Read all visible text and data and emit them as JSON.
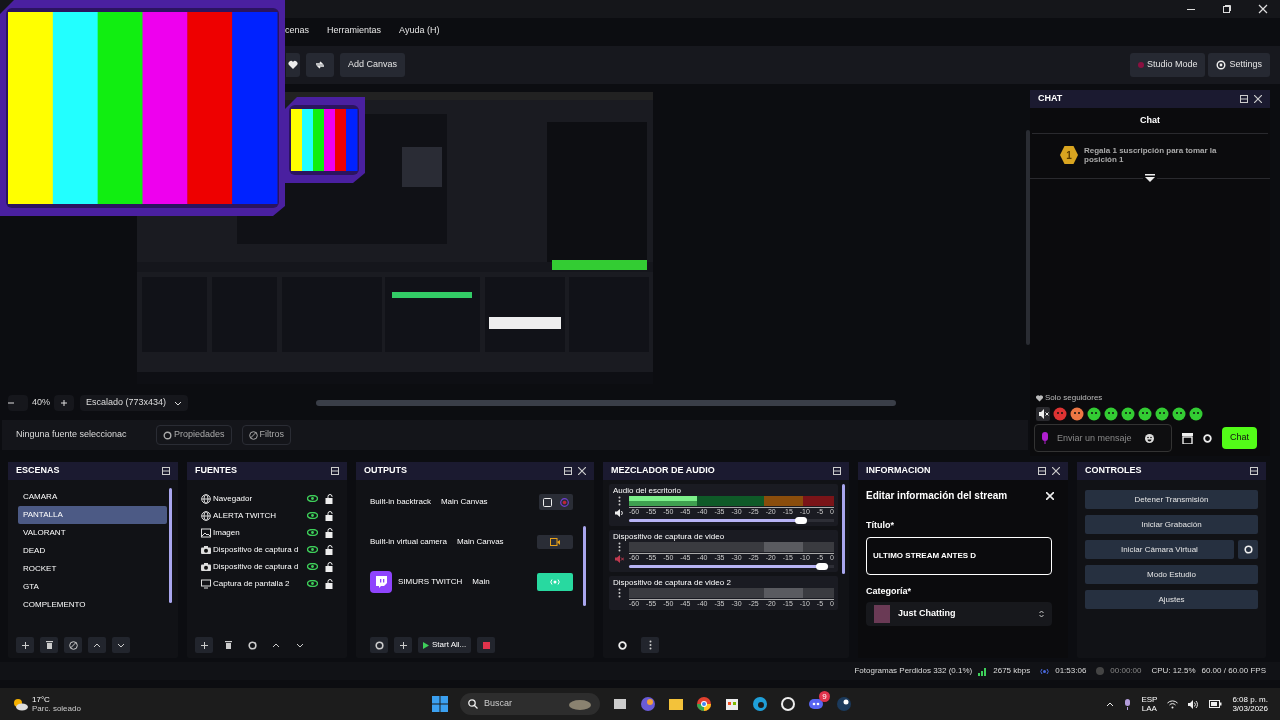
{
  "menu": [
    {
      "label": "cenas"
    },
    {
      "label": "Herramientas"
    },
    {
      "label": "Ayuda (H)"
    }
  ],
  "toolbar": {
    "left": [
      {
        "kind": "heart"
      },
      {
        "kind": "transition"
      },
      {
        "kind": "text",
        "label": "Add Canvas"
      }
    ],
    "right": [
      {
        "kind": "studio",
        "label": "Studio Mode"
      },
      {
        "kind": "settings",
        "label": "Settings"
      }
    ]
  },
  "preview": {
    "zoom": "40%",
    "scale_mode": "Escalado (773x434)"
  },
  "source_bar": {
    "status": "Ninguna fuente seleccionac",
    "buttons": [
      {
        "kind": "gear",
        "label": "Propiedades"
      },
      {
        "kind": "filter",
        "label": "Filtros"
      }
    ]
  },
  "chat": {
    "title": "CHAT",
    "heading": "Chat",
    "pinned_rank": "1",
    "pinned_text": "Regala 1 suscripción para tomar la posición 1",
    "mode": "Solo seguidores",
    "placeholder": "Enviar un mensaje",
    "send_label": "Chat"
  },
  "scenes": {
    "title": "ESCENAS",
    "items": [
      {
        "label": "CAMARA",
        "selected": false
      },
      {
        "label": "PANTALLA",
        "selected": true
      },
      {
        "label": "VALORANT",
        "selected": false
      },
      {
        "label": "DEAD",
        "selected": false
      },
      {
        "label": "ROCKET",
        "selected": false
      },
      {
        "label": "GTA",
        "selected": false
      },
      {
        "label": "COMPLEMENTO",
        "selected": false
      }
    ]
  },
  "sources": {
    "title": "FUENTES",
    "items": [
      {
        "kind": "globe",
        "label": "Navegador",
        "visible": true,
        "locked": false
      },
      {
        "kind": "globe",
        "label": "ALERTA TWITCH",
        "visible": true,
        "locked": false
      },
      {
        "kind": "image",
        "label": "Imagen",
        "visible": true,
        "locked": false
      },
      {
        "kind": "camera",
        "label": "Dispositivo de captura d",
        "visible": true,
        "locked": false
      },
      {
        "kind": "camera",
        "label": "Dispositivo de captura d",
        "visible": true,
        "locked": false
      },
      {
        "kind": "monitor",
        "label": "Captura de pantalla 2",
        "visible": true,
        "locked": false
      }
    ]
  },
  "outputs": {
    "title": "OUTPUTS",
    "rows": [
      {
        "kind": "backtrack",
        "name": "Built-in backtrack",
        "canvas": "Main Canvas"
      },
      {
        "kind": "virtualcam",
        "name": "Built-in virtual camera",
        "canvas": "Main Canvas"
      },
      {
        "kind": "stream",
        "name": "SIMURS TWITCH",
        "canvas": "Main",
        "active": true
      }
    ],
    "start_all": "Start All..."
  },
  "mixer": {
    "title": "MEZCLADOR DE AUDIO",
    "channels": [
      {
        "name": "Audio del escritorio",
        "meter": {
          "level": 0.33
        },
        "scale": [
          "-60",
          "-55",
          "-50",
          "-45",
          "-40",
          "-35",
          "-30",
          "-25",
          "-20",
          "-15",
          "-10",
          "-5",
          "0"
        ],
        "volume": {
          "level": 0.86
        },
        "muted": false
      },
      {
        "name": "Dispositivo de captura de video",
        "scale": [
          "-60",
          "-55",
          "-50",
          "-45",
          "-40",
          "-35",
          "-30",
          "-25",
          "-20",
          "-15",
          "-10",
          "-5",
          "0"
        ],
        "volume": {
          "level": 0.97
        },
        "muted": true
      },
      {
        "name": "Dispositivo de captura de video 2",
        "scale": [
          "-60",
          "-55",
          "-50",
          "-45",
          "-40",
          "-35",
          "-30",
          "-25",
          "-20",
          "-15",
          "-10",
          "-5",
          "0"
        ]
      }
    ]
  },
  "info": {
    "title": "INFORMACION",
    "heading": "Editar información del stream",
    "title_label": "Título*",
    "title_value": "ULTIMO STREAM ANTES D",
    "category_label": "Categoría*",
    "category": "Just Chatting"
  },
  "controls": {
    "title": "CONTROLES",
    "buttons": [
      {
        "label": "Detener Transmisión",
        "gear": false
      },
      {
        "label": "Iniciar Grabación",
        "gear": false
      },
      {
        "label": "Iniciar Cámara Virtual",
        "gear": true
      },
      {
        "label": "Modo Estudio",
        "gear": false
      },
      {
        "label": "Ajustes",
        "gear": false
      }
    ]
  },
  "status_bar": {
    "dropped": "Fotogramas Perdidos 332 (0.1%)",
    "bitrate": "2675 kbps",
    "stream_time": "01:53:06",
    "rec_time": "00:00:00",
    "cpu": "CPU: 12.5%",
    "fps": "60.00 / 60.00 FPS"
  },
  "taskbar": {
    "temperature": "17°C",
    "weather": "Parc. soleado",
    "search": "Buscar",
    "discord_badge": "9",
    "lang": "ESP",
    "layout": "LAA",
    "time": "6:08 p. m.",
    "date": "3/03/2026"
  }
}
